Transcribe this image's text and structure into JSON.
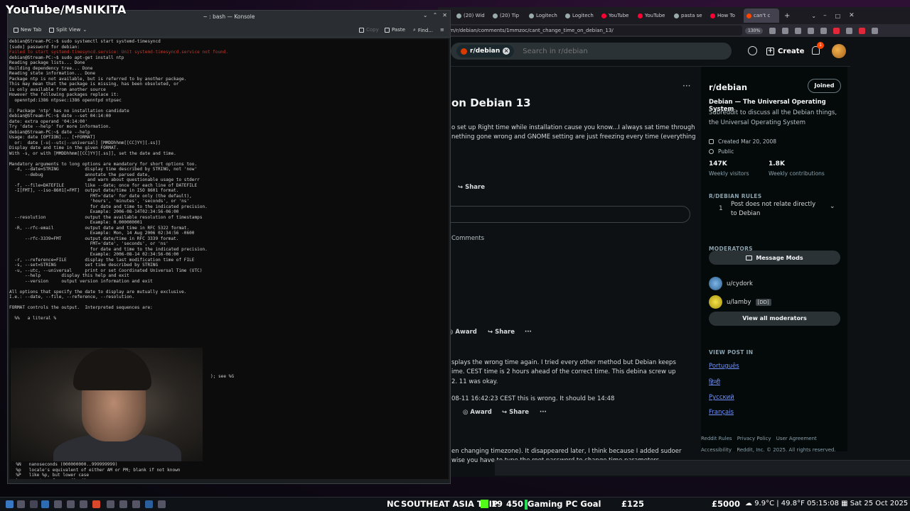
{
  "watermark": "YouTube/MsNIKITA",
  "konsole": {
    "title": "~ : bash — Konsole",
    "toolbar": {
      "new_tab": "New Tab",
      "split_view": "Split View",
      "copy": "Copy",
      "paste": "Paste",
      "find": "Find..."
    },
    "terminal_lines_1": "debian@Stream-PC:~$ sudo systemctl start systemd-timesyncd\n[sudo] password for debian:",
    "terminal_error": "Failed to start systemd-timesyncd.service: Unit systemd-timesyncd.service not found.",
    "terminal_lines_2": "debian@Stream-PC:~$ sudo apt-get install ntp\nReading package lists... Done\nBuilding dependency tree... Done\nReading state information... Done\nPackage ntp is not available, but is referred to by another package.\nThis may mean that the package is missing, has been obsoleted, or\nis only available from another source\nHowever the following packages replace it:\n  openntpd:i386 ntpsec:i386 openntpd ntpsec\n\nE: Package 'ntp' has no installation candidate\ndebian@Stream-PC:~$ date --set 04:14:00\ndate: extra operand '04:14:00'\nTry 'date --help' for more information.\ndebian@Stream-PC:~$ date --help\nUsage: date [OPTION]... [+FORMAT]\n  or:  date [-u|--utc|--universal] [MMDDhhmm[[CC]YY][.ss]]\nDisplay date and time in the given FORMAT.\nWith -s, or with [MMDDhhmm[[CC]YY][.ss]], set the date and time.\n\nMandatory arguments to long options are mandatory for short options too.\n  -d, --date=STRING          display time described by STRING, not 'now'\n      --debug                annotate the parsed date,\n                              and warn about questionable usage to stderr\n  -f, --file=DATEFILE        like --date; once for each line of DATEFILE\n  -I[FMT], --iso-8601[=FMT]  output date/time in ISO 8601 format.\n                               FMT='date' for date only (the default),\n                               'hours', 'minutes', 'seconds', or 'ns'\n                               for date and time to the indicated precision.\n                               Example: 2006-08-14T02:34:56-06:00\n  --resolution               output the available resolution of timestamps\n                               Example: 0.000000001\n  -R, --rfc-email            output date and time in RFC 5322 format.\n                               Example: Mon, 14 Aug 2006 02:34:56 -0600\n      --rfc-3339=FMT         output date/time in RFC 3339 format.\n                               FMT='date', 'seconds', or 'ns'\n                               for date and time to the indicated precision.\n                               Example: 2006-08-14 02:34:56-06:00\n  -r, --reference=FILE       display the last modification time of FILE\n  -s, --set=STRING           set time described by STRING\n  -u, --utc, --universal     print or set Coordinated Universal Time (UTC)\n      --help        display this help and exit\n      --version     output version information and exit\n\nAll options that specify the date to display are mutually exclusive.\nI.e.: --date, --file, --reference, --resolution.\n\nFORMAT controls the output.  Interpreted sequences are:\n\n  %%   a literal %",
    "terminal_see": "); see %G",
    "terminal_tail": "  %N   nanoseconds (000000000..999999999)\n  %p   locale's equivalent of either AM or PM; blank if not known\n  %P   like %p, but lower case\n  %q   quarter of year (1..4)\n  %r   locale's 12-hour clock time (e.g., 11:11:04 PM)\n  %R   24-hour hour and minute; same as %H:%M\n  %s   seconds since the Epoch (1970-01-01 00:00 UTC)\n  %S   second (00..60)\n  %t   a tab"
  },
  "browser": {
    "tabs": [
      {
        "label": "(20) Wid",
        "icon": "gray"
      },
      {
        "label": "(20) Tip",
        "icon": "gray"
      },
      {
        "label": "Logitech",
        "icon": "gray"
      },
      {
        "label": "Logitech",
        "icon": "gray"
      },
      {
        "label": "YouTube",
        "icon": "red"
      },
      {
        "label": "YouTube",
        "icon": "red"
      },
      {
        "label": "pasta se",
        "icon": "gray"
      },
      {
        "label": "How To",
        "icon": "red"
      },
      {
        "label": "can't c",
        "icon": "reddit",
        "active": true
      }
    ],
    "url": "om/r/debian/comments/1mmzoc/cant_change_time_on_debian_13/",
    "zoom": "130%",
    "right_hint": "lose",
    "right_hint2": "free"
  },
  "reddit": {
    "search_chip": "r/debian",
    "search_placeholder": "Search in r/debian",
    "create_label": "Create",
    "notif_count": "1",
    "post": {
      "title": "on Debian 13",
      "body_line1": "o set up Right time while installation cause you know...I always sat time through",
      "body_line2": "nething gone wrong and GNOME setting are just freezing every time (everything",
      "share": "Share",
      "comments_label": "Comments",
      "award": "Award",
      "share2": "Share",
      "more": "···",
      "comment1_line1": "splays the wrong time again. I tried every other method but Debian keeps",
      "comment1_line2": "ime. CEST time is 2 hours ahead of the correct time. This debina screw up",
      "comment1_line3": "2. 11 was okay.",
      "comment2": "08-11 16:42:23 CEST this is wrong. It should be 14:48",
      "award2": "Award",
      "share3": "Share",
      "more2": "···",
      "comment3_line1": "en changing timezone). It disappeared later, I think because I added sudoer",
      "comment3_line2": "wise you have to type the root password to change time parameters."
    },
    "sidebar": {
      "name": "r/debian",
      "joined": "Joined",
      "title": "Debian — The Universal Operating System",
      "desc": "Subreddit to discuss all the Debian things, the Universal Operating System",
      "created": "Created Mar 20, 2008",
      "visibility": "Public",
      "visitors_num": "147K",
      "visitors_label": "Weekly visitors",
      "contrib_num": "1.8K",
      "contrib_label": "Weekly contributions",
      "rules_heading": "R/DEBIAN RULES",
      "rule_num": "1",
      "rule_text": "Post does not relate directly to Debian",
      "mods_heading": "MODERATORS",
      "message_mods": "Message Mods",
      "mod1": "u/cydork",
      "mod2": "u/lamby",
      "mod2_flair": "[DD]",
      "view_all": "View all moderators",
      "view_post_in": "VIEW POST IN",
      "languages": [
        "Português",
        "हिन्दी",
        "Русский",
        "Français"
      ],
      "footer": [
        "Reddit Rules",
        "Privacy Policy",
        "User Agreement"
      ],
      "footer2": [
        "Accessibility",
        "Reddit, Inc. © 2025. All rights reserved."
      ]
    }
  },
  "taskbar": {
    "flag": "NC",
    "trip": "SOUTHEAT ASIA TRIP",
    "kick_count": "19",
    "count2": "450",
    "goal": "Gaming PC Goal",
    "amount": "£125",
    "target": "£5000",
    "weather": "9.9°C | 49.8°F",
    "time": "05:15:08",
    "date": "Sat 25 Oct 2025"
  },
  "colors": {
    "reddit_orange": "#ff4500",
    "link_blue": "#7193ff",
    "error_red": "#c0392b",
    "kick_green": "#53fc18"
  }
}
